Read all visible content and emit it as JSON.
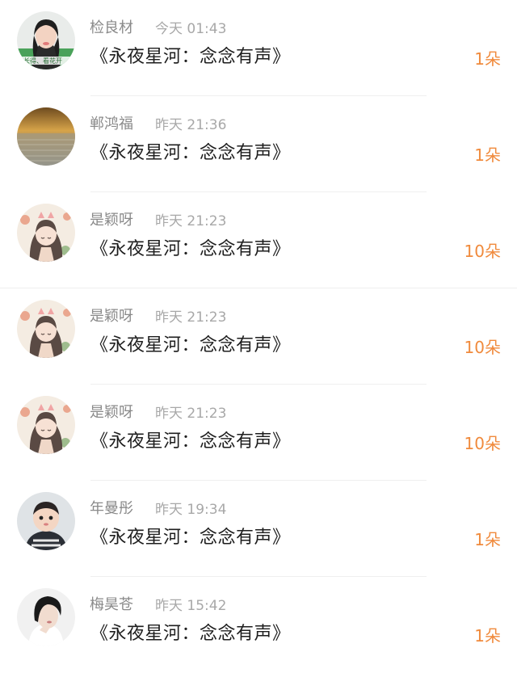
{
  "gifts": [
    {
      "user": "检良材",
      "time": "今天 01:43",
      "title": "《永夜星河：念念有声》",
      "count": "1朵",
      "avatar_icon": "avatar-girl-flowers"
    },
    {
      "user": "郸鸿福",
      "time": "昨天 21:36",
      "title": "《永夜星河：念念有声》",
      "count": "1朵",
      "avatar_icon": "avatar-sunset-sea"
    },
    {
      "user": "是颖呀",
      "time": "昨天 21:23",
      "title": "《永夜星河：念念有声》",
      "count": "10朵",
      "avatar_icon": "avatar-anime-girl"
    },
    {
      "user": "是颖呀",
      "time": "昨天 21:23",
      "title": "《永夜星河：念念有声》",
      "count": "10朵",
      "avatar_icon": "avatar-anime-girl"
    },
    {
      "user": "是颖呀",
      "time": "昨天 21:23",
      "title": "《永夜星河：念念有声》",
      "count": "10朵",
      "avatar_icon": "avatar-anime-girl"
    },
    {
      "user": "年曼彤",
      "time": "昨天 19:34",
      "title": "《永夜星河：念念有声》",
      "count": "1朵",
      "avatar_icon": "avatar-baby"
    },
    {
      "user": "梅昊苍",
      "time": "昨天 15:42",
      "title": "《永夜星河：念念有声》",
      "count": "1朵",
      "avatar_icon": "avatar-woman-portrait"
    }
  ],
  "colors": {
    "count": "#f08a3c",
    "name": "#8a8a8a",
    "time": "#a8a8a8",
    "title": "#1e1e1e"
  }
}
